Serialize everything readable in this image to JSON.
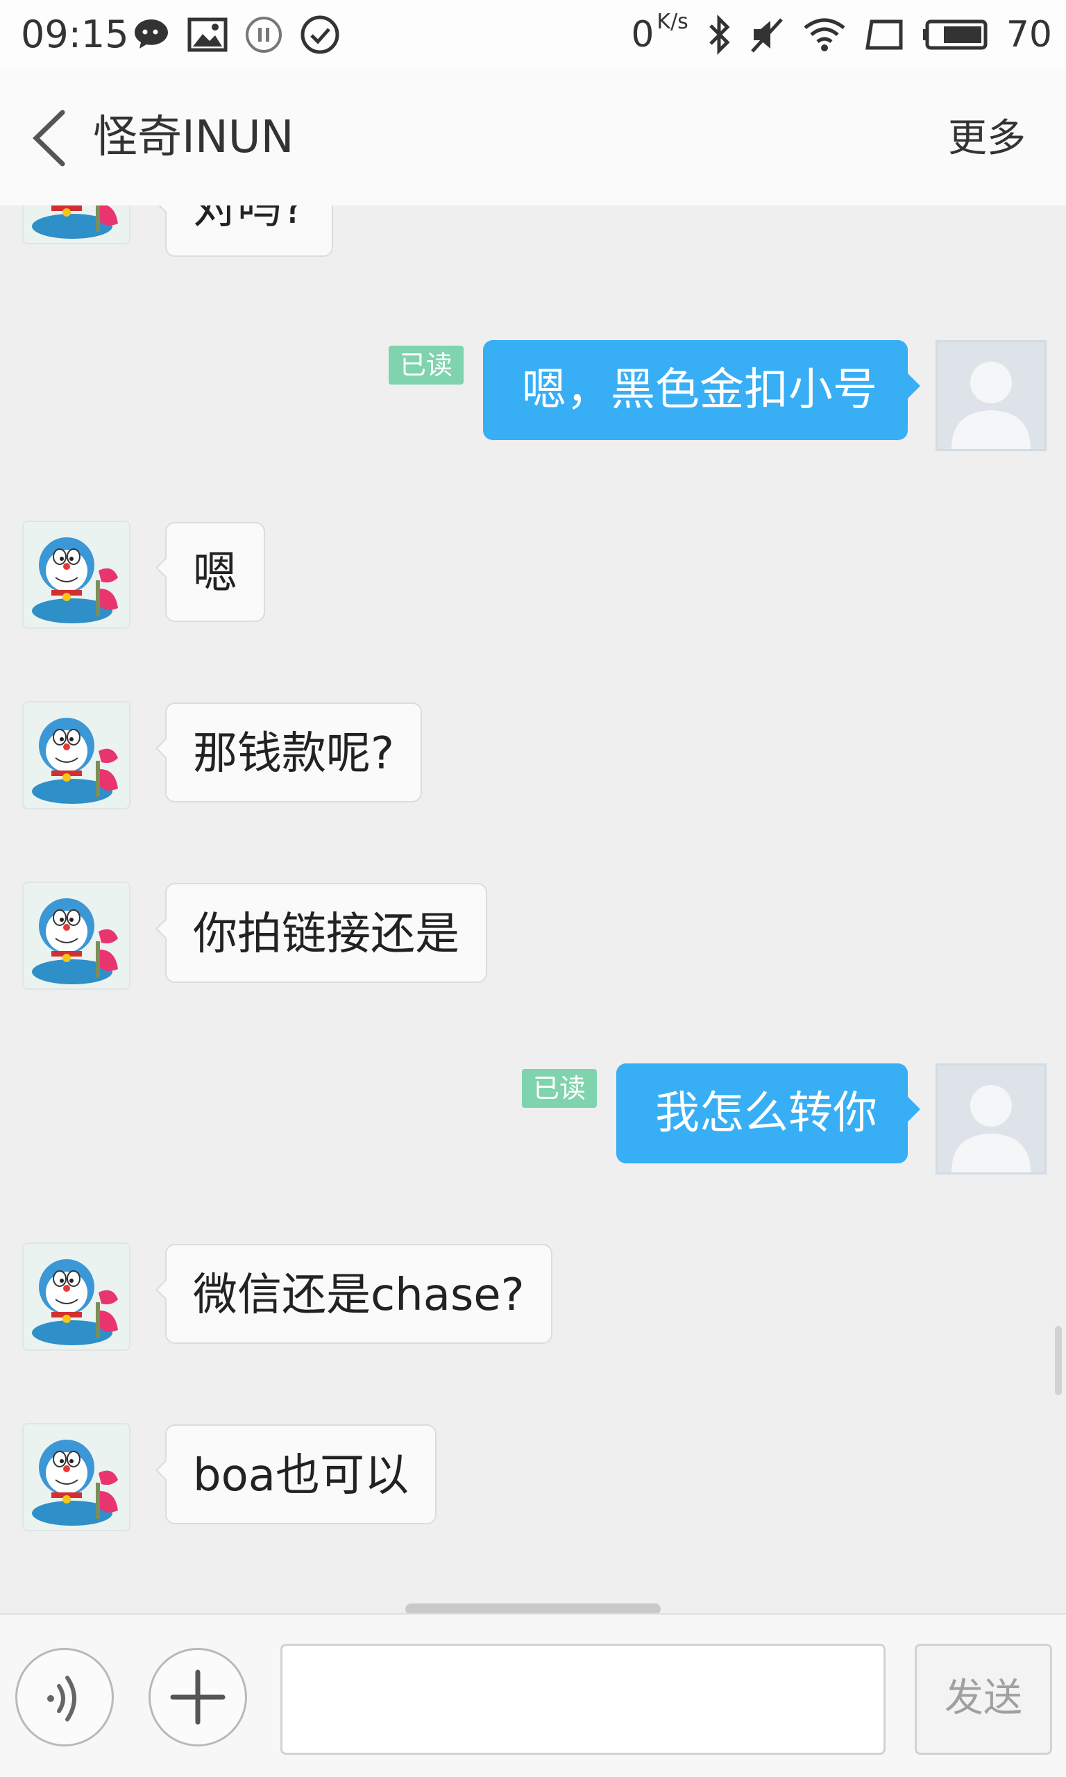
{
  "status_bar": {
    "time": "09:15",
    "speed_value": "0",
    "speed_unit": "K/s",
    "battery": "70",
    "icons": [
      "chat-bubble-icon",
      "image-icon",
      "pause-icon",
      "check-circle-icon",
      "bluetooth-icon",
      "mute-icon",
      "wifi-icon",
      "screen-rotate-icon",
      "battery-icon"
    ]
  },
  "header": {
    "back_icon": "chevron-left-icon",
    "title": "怪奇INUN",
    "more_label": "更多"
  },
  "messages": [
    {
      "sender": "other",
      "text": "对吗?",
      "partially_visible": true
    },
    {
      "sender": "me",
      "text": "嗯，黑色金扣小号",
      "read_label": "已读"
    },
    {
      "sender": "other",
      "text": "嗯"
    },
    {
      "sender": "other",
      "text": "那钱款呢?"
    },
    {
      "sender": "other",
      "text": "你拍链接还是"
    },
    {
      "sender": "me",
      "text": "我怎么转你",
      "read_label": "已读"
    },
    {
      "sender": "other",
      "text": "微信还是chase?"
    },
    {
      "sender": "other",
      "text": "boa也可以"
    }
  ],
  "input_bar": {
    "voice_icon": "voice-icon",
    "plus_icon": "plus-icon",
    "input_value": "",
    "send_label": "发送"
  },
  "colors": {
    "outgoing_bubble": "#38aef5",
    "read_badge": "#7fd3ad",
    "background": "#efefef"
  }
}
